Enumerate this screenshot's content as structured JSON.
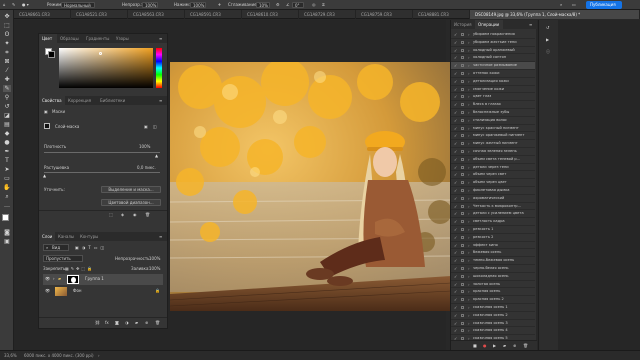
{
  "options_bar": {
    "mode_label": "Режим:",
    "mode_value": "Нормальный",
    "opacity_label": "Непрозр.:",
    "opacity_value": "100%",
    "flow_label": "Нажим:",
    "flow_value": "100%",
    "smoothing_label": "Сглаживание:",
    "smoothing_value": "10%",
    "angle_value": "0°",
    "share_label": "Публикация"
  },
  "doc_tabs": [
    "CG1A8661.CR3",
    "CG1A8521.CR3",
    "CG1A8563.CR3",
    "CG1A8591.CR3",
    "CG1A8610.CR3",
    "CG1A8729.CR3",
    "CG1A8759.CR3",
    "CG1A8881.CR3",
    "DSC08149.jpg @ 33,6% (Группа 1, Слой-маска/8) *"
  ],
  "color_panel": {
    "tabs": [
      "Цвет",
      "Образцы",
      "Градиенты",
      "Узоры"
    ],
    "hue_color": "#f0a020"
  },
  "properties_panel": {
    "tabs": [
      "Свойства",
      "Коррекция",
      "Библиотеки"
    ],
    "mask_label": "Маски",
    "layer_mask_label": "Слой-маска",
    "density_label": "Плотность",
    "density_value": "100%",
    "feather_label": "Растушевка",
    "feather_value": "0,0 пикс.",
    "refine_label": "Уточнить:",
    "select_and_mask_button": "Выделение и маска...",
    "color_range_button": "Цветовой диапазон..."
  },
  "layers_panel": {
    "tabs": [
      "Слои",
      "Каналы",
      "Контуры"
    ],
    "filter_kind": "Вид",
    "blend_mode": "Пропустить",
    "opacity_label": "Непрозрачность:",
    "opacity_value": "100%",
    "lock_label": "Закрепить:",
    "fill_label": "Заливка:",
    "fill_value": "100%",
    "layers": [
      {
        "name": "Группа 1"
      },
      {
        "name": "Фон"
      }
    ]
  },
  "history_panel": {
    "tabs": [
      "История",
      "Операции"
    ],
    "actions": [
      "убираем покраснения",
      "убираем жесткие тени",
      "холодный оранжевый",
      "холодный сонтон",
      "частичное размывание",
      "оттенок кожи",
      "детализация кожи",
      "смягчение кожи",
      "цвет глаз",
      "блеск в глазах",
      "белоснежные зубы",
      "стилизация волос",
      "минус красный пигмент",
      "минус оранжевый пигмент",
      "минус желтый пигмент",
      "сочная зеленая зелень",
      "объем света теневой р...",
      "детали через тени",
      "объем через свет",
      "объем через цвет",
      "фиолетовая дымка",
      "ахроматический",
      "Четкость к микроконтр...",
      "детали с усилением цвета",
      "светлость кадра",
      "резкость 1",
      "резкость 2",
      "эффект кино",
      "бежевая осень",
      "темно-бежевая осень",
      "черно-белая осень",
      "шоколадная осень",
      "золотая осень",
      "красная осень",
      "красная осень 2",
      "сказочная осень 1",
      "сказочная осень 2",
      "сказочная осень 3",
      "сказочная осень 4",
      "сказочная осень 5",
      "сказочная осень 6"
    ],
    "selected_index": 4
  },
  "status_bar": {
    "zoom": "33,6%",
    "doc_info": "6000 пикс. x 4000 пикс. (300 ppi)"
  }
}
